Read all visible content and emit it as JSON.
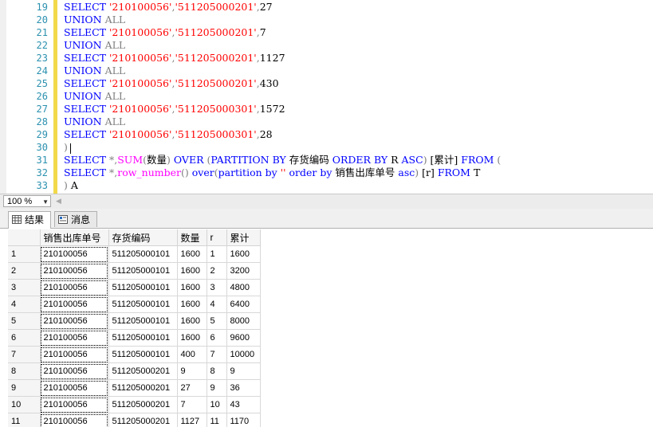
{
  "editor": {
    "lines": [
      {
        "n": "19",
        "parts": [
          [
            "kw",
            "SELECT "
          ],
          [
            "str",
            "'210100056'"
          ],
          [
            "gr",
            ","
          ],
          [
            "str",
            "'511205000201'"
          ],
          [
            "gr",
            ","
          ],
          [
            "txt",
            "27"
          ]
        ]
      },
      {
        "n": "20",
        "parts": [
          [
            "kw",
            "UNION "
          ],
          [
            "gr",
            "ALL"
          ]
        ]
      },
      {
        "n": "21",
        "parts": [
          [
            "kw",
            "SELECT "
          ],
          [
            "str",
            "'210100056'"
          ],
          [
            "gr",
            ","
          ],
          [
            "str",
            "'511205000201'"
          ],
          [
            "gr",
            ","
          ],
          [
            "txt",
            "7"
          ]
        ]
      },
      {
        "n": "22",
        "parts": [
          [
            "kw",
            "UNION "
          ],
          [
            "gr",
            "ALL"
          ]
        ]
      },
      {
        "n": "23",
        "parts": [
          [
            "kw",
            "SELECT "
          ],
          [
            "str",
            "'210100056'"
          ],
          [
            "gr",
            ","
          ],
          [
            "str",
            "'511205000201'"
          ],
          [
            "gr",
            ","
          ],
          [
            "txt",
            "1127"
          ]
        ]
      },
      {
        "n": "24",
        "parts": [
          [
            "kw",
            "UNION "
          ],
          [
            "gr",
            "ALL"
          ]
        ]
      },
      {
        "n": "25",
        "parts": [
          [
            "kw",
            "SELECT "
          ],
          [
            "str",
            "'210100056'"
          ],
          [
            "gr",
            ","
          ],
          [
            "str",
            "'511205000201'"
          ],
          [
            "gr",
            ","
          ],
          [
            "txt",
            "430"
          ]
        ]
      },
      {
        "n": "26",
        "parts": [
          [
            "kw",
            "UNION "
          ],
          [
            "gr",
            "ALL"
          ]
        ]
      },
      {
        "n": "27",
        "parts": [
          [
            "kw",
            "SELECT "
          ],
          [
            "str",
            "'210100056'"
          ],
          [
            "gr",
            ","
          ],
          [
            "str",
            "'511205000301'"
          ],
          [
            "gr",
            ","
          ],
          [
            "txt",
            "1572"
          ]
        ]
      },
      {
        "n": "28",
        "parts": [
          [
            "kw",
            "UNION "
          ],
          [
            "gr",
            "ALL"
          ]
        ]
      },
      {
        "n": "29",
        "parts": [
          [
            "kw",
            "SELECT "
          ],
          [
            "str",
            "'210100056'"
          ],
          [
            "gr",
            ","
          ],
          [
            "str",
            "'511205000301'"
          ],
          [
            "gr",
            ","
          ],
          [
            "txt",
            "28"
          ]
        ]
      },
      {
        "n": "30",
        "parts": [
          [
            "gr",
            ")"
          ]
        ]
      },
      {
        "n": "31",
        "parts": [
          [
            "kw",
            "SELECT "
          ],
          [
            "gr",
            "*,"
          ],
          [
            "fn",
            "SUM"
          ],
          [
            "gr",
            "("
          ],
          [
            "txt",
            "数量"
          ],
          [
            "gr",
            ") "
          ],
          [
            "kw",
            "OVER "
          ],
          [
            "gr",
            "("
          ],
          [
            "kw",
            "PARTITION BY "
          ],
          [
            "txt",
            "存货编码 "
          ],
          [
            "kw",
            "ORDER BY "
          ],
          [
            "txt",
            "R "
          ],
          [
            "kw",
            "ASC"
          ],
          [
            "gr",
            ") "
          ],
          [
            "txt",
            "[累计] "
          ],
          [
            "kw",
            "FROM "
          ],
          [
            "gr",
            "("
          ]
        ]
      },
      {
        "n": "32",
        "parts": [
          [
            "kw",
            "SELECT "
          ],
          [
            "gr",
            "*,"
          ],
          [
            "fn",
            "row_number"
          ],
          [
            "gr",
            "() "
          ],
          [
            "kw",
            "over"
          ],
          [
            "gr",
            "("
          ],
          [
            "kw",
            "partition by "
          ],
          [
            "str",
            "''"
          ],
          [
            "kw",
            " order by "
          ],
          [
            "txt",
            "销售出库单号 "
          ],
          [
            "kw",
            "asc"
          ],
          [
            "gr",
            ") "
          ],
          [
            "txt",
            "[r] "
          ],
          [
            "kw",
            "FROM "
          ],
          [
            "txt",
            "T"
          ]
        ]
      },
      {
        "n": "33",
        "parts": [
          [
            "gr",
            ") "
          ],
          [
            "txt",
            "A"
          ]
        ]
      }
    ]
  },
  "zoom": {
    "value": "100 %"
  },
  "tabs": [
    {
      "label": "结果",
      "icon": "grid-icon"
    },
    {
      "label": "消息",
      "icon": "messages-icon"
    }
  ],
  "results": {
    "columns": [
      "销售出库单号",
      "存货编码",
      "数量",
      "r",
      "累计"
    ],
    "rows": [
      [
        "1",
        "210100056",
        "511205000101",
        "1600",
        "1",
        "1600"
      ],
      [
        "2",
        "210100056",
        "511205000101",
        "1600",
        "2",
        "3200"
      ],
      [
        "3",
        "210100056",
        "511205000101",
        "1600",
        "3",
        "4800"
      ],
      [
        "4",
        "210100056",
        "511205000101",
        "1600",
        "4",
        "6400"
      ],
      [
        "5",
        "210100056",
        "511205000101",
        "1600",
        "5",
        "8000"
      ],
      [
        "6",
        "210100056",
        "511205000101",
        "1600",
        "6",
        "9600"
      ],
      [
        "7",
        "210100056",
        "511205000101",
        "400",
        "7",
        "10000"
      ],
      [
        "8",
        "210100056",
        "511205000201",
        "9",
        "8",
        "9"
      ],
      [
        "9",
        "210100056",
        "511205000201",
        "27",
        "9",
        "36"
      ],
      [
        "10",
        "210100056",
        "511205000201",
        "7",
        "10",
        "43"
      ],
      [
        "11",
        "210100056",
        "511205000201",
        "1127",
        "11",
        "1170"
      ]
    ]
  }
}
